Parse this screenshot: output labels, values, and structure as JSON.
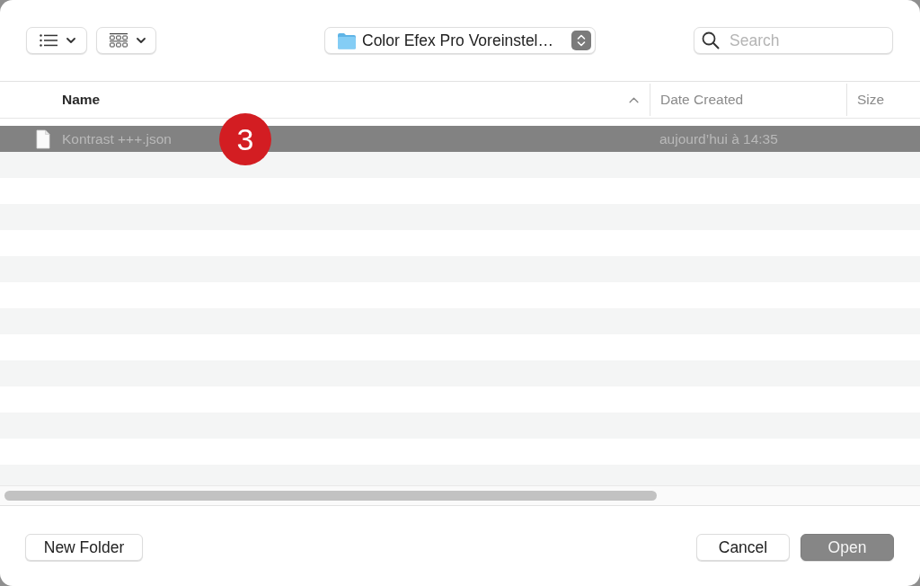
{
  "toolbar": {
    "location": {
      "title": "Color Efex Pro Voreinstel…"
    },
    "search": {
      "placeholder": "Search"
    }
  },
  "table": {
    "columns": [
      {
        "label": "Name",
        "sorted": true
      },
      {
        "label": "Date Created",
        "sorted": false
      },
      {
        "label": "Size",
        "sorted": false
      }
    ],
    "rows": [
      {
        "name": "Kontrast +++.json",
        "date_created": "aujourd’hui à 14:35",
        "selected": true
      }
    ]
  },
  "callout": {
    "number": "3"
  },
  "footer": {
    "left_buttons": [
      {
        "label": "New Folder",
        "kind": "normal"
      }
    ],
    "right_buttons": [
      {
        "label": "Cancel",
        "kind": "normal"
      },
      {
        "label": "Open",
        "kind": "default"
      }
    ]
  }
}
